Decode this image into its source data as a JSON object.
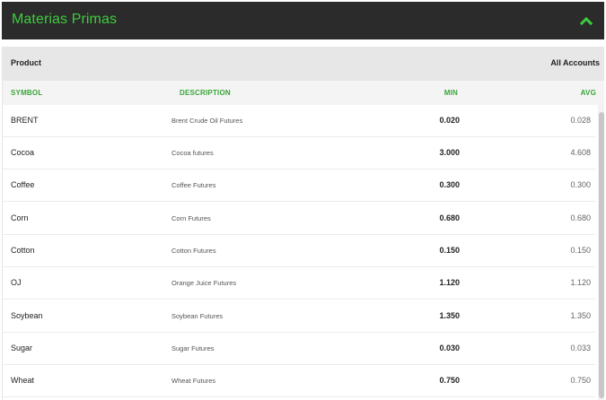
{
  "header": {
    "title": "Materias Primas",
    "collapse_icon": "chevron-up-icon",
    "accent": "#3ecb3e"
  },
  "toolbar": {
    "product_label": "Product",
    "accounts_label": "All Accounts"
  },
  "columns": {
    "symbol": "SYMBOL",
    "description": "DESCRIPTION",
    "min": "MIN",
    "avg": "AVG"
  },
  "rows": [
    {
      "symbol": "BRENT",
      "description": "Brent Crude Oil Futures",
      "min": "0.020",
      "avg": "0.028"
    },
    {
      "symbol": "Cocoa",
      "description": "Cocoa futures",
      "min": "3.000",
      "avg": "4.608"
    },
    {
      "symbol": "Coffee",
      "description": "Coffee Futures",
      "min": "0.300",
      "avg": "0.300"
    },
    {
      "symbol": "Corn",
      "description": "Corn Futures",
      "min": "0.680",
      "avg": "0.680"
    },
    {
      "symbol": "Cotton",
      "description": "Cotton Futures",
      "min": "0.150",
      "avg": "0.150"
    },
    {
      "symbol": "OJ",
      "description": "Orange Juice Futures",
      "min": "1.120",
      "avg": "1.120"
    },
    {
      "symbol": "Soybean",
      "description": "Soybean Futures",
      "min": "1.350",
      "avg": "1.350"
    },
    {
      "symbol": "Sugar",
      "description": "Sugar Futures",
      "min": "0.030",
      "avg": "0.033"
    },
    {
      "symbol": "Wheat",
      "description": "Wheat Futures",
      "min": "0.750",
      "avg": "0.750"
    }
  ]
}
